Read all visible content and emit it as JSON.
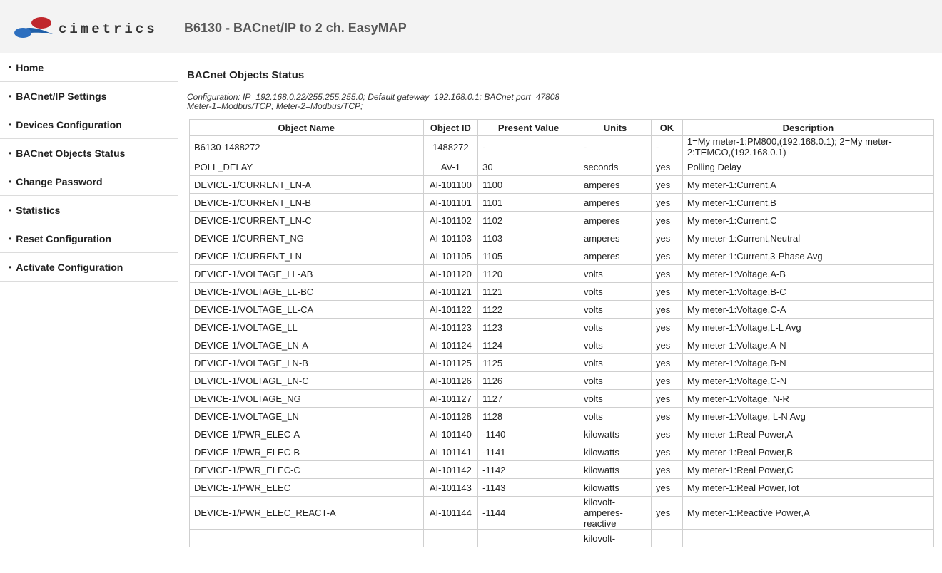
{
  "header": {
    "logo_text": "cimetrics",
    "title": "B6130 - BACnet/IP to 2 ch. EasyMAP"
  },
  "sidebar": {
    "items": [
      {
        "label": "Home"
      },
      {
        "label": "BACnet/IP Settings"
      },
      {
        "label": "Devices Configuration"
      },
      {
        "label": "BACnet Objects Status"
      },
      {
        "label": "Change Password"
      },
      {
        "label": "Statistics"
      },
      {
        "label": "Reset Configuration"
      },
      {
        "label": "Activate Configuration"
      }
    ]
  },
  "main": {
    "title": "BACnet Objects Status",
    "config_line1": "Configuration: IP=192.168.0.22/255.255.255.0; Default gateway=192.168.0.1; BACnet port=47808",
    "config_line2": "Meter-1=Modbus/TCP; Meter-2=Modbus/TCP;",
    "table": {
      "headers": [
        "Object Name",
        "Object ID",
        "Present Value",
        "Units",
        "OK",
        "Description"
      ],
      "rows": [
        [
          "B6130-1488272",
          "1488272",
          "-",
          "-",
          "-",
          "1=My meter-1:PM800,(192.168.0.1); 2=My meter-2:TEMCO,(192.168.0.1)"
        ],
        [
          "POLL_DELAY",
          "AV-1",
          "30",
          "seconds",
          "yes",
          "Polling Delay"
        ],
        [
          "DEVICE-1/CURRENT_LN-A",
          "AI-101100",
          "1100",
          "amperes",
          "yes",
          "My meter-1:Current,A"
        ],
        [
          "DEVICE-1/CURRENT_LN-B",
          "AI-101101",
          "1101",
          "amperes",
          "yes",
          "My meter-1:Current,B"
        ],
        [
          "DEVICE-1/CURRENT_LN-C",
          "AI-101102",
          "1102",
          "amperes",
          "yes",
          "My meter-1:Current,C"
        ],
        [
          "DEVICE-1/CURRENT_NG",
          "AI-101103",
          "1103",
          "amperes",
          "yes",
          "My meter-1:Current,Neutral"
        ],
        [
          "DEVICE-1/CURRENT_LN",
          "AI-101105",
          "1105",
          "amperes",
          "yes",
          "My meter-1:Current,3-Phase Avg"
        ],
        [
          "DEVICE-1/VOLTAGE_LL-AB",
          "AI-101120",
          "1120",
          "volts",
          "yes",
          "My meter-1:Voltage,A-B"
        ],
        [
          "DEVICE-1/VOLTAGE_LL-BC",
          "AI-101121",
          "1121",
          "volts",
          "yes",
          "My meter-1:Voltage,B-C"
        ],
        [
          "DEVICE-1/VOLTAGE_LL-CA",
          "AI-101122",
          "1122",
          "volts",
          "yes",
          "My meter-1:Voltage,C-A"
        ],
        [
          "DEVICE-1/VOLTAGE_LL",
          "AI-101123",
          "1123",
          "volts",
          "yes",
          "My meter-1:Voltage,L-L Avg"
        ],
        [
          "DEVICE-1/VOLTAGE_LN-A",
          "AI-101124",
          "1124",
          "volts",
          "yes",
          "My meter-1:Voltage,A-N"
        ],
        [
          "DEVICE-1/VOLTAGE_LN-B",
          "AI-101125",
          "1125",
          "volts",
          "yes",
          "My meter-1:Voltage,B-N"
        ],
        [
          "DEVICE-1/VOLTAGE_LN-C",
          "AI-101126",
          "1126",
          "volts",
          "yes",
          "My meter-1:Voltage,C-N"
        ],
        [
          "DEVICE-1/VOLTAGE_NG",
          "AI-101127",
          "1127",
          "volts",
          "yes",
          "My meter-1:Voltage, N-R"
        ],
        [
          "DEVICE-1/VOLTAGE_LN",
          "AI-101128",
          "1128",
          "volts",
          "yes",
          "My meter-1:Voltage, L-N Avg"
        ],
        [
          "DEVICE-1/PWR_ELEC-A",
          "AI-101140",
          "-1140",
          "kilowatts",
          "yes",
          "My meter-1:Real Power,A"
        ],
        [
          "DEVICE-1/PWR_ELEC-B",
          "AI-101141",
          "-1141",
          "kilowatts",
          "yes",
          "My meter-1:Real Power,B"
        ],
        [
          "DEVICE-1/PWR_ELEC-C",
          "AI-101142",
          "-1142",
          "kilowatts",
          "yes",
          "My meter-1:Real Power,C"
        ],
        [
          "DEVICE-1/PWR_ELEC",
          "AI-101143",
          "-1143",
          "kilowatts",
          "yes",
          "My meter-1:Real Power,Tot"
        ],
        [
          "DEVICE-1/PWR_ELEC_REACT-A",
          "AI-101144",
          "-1144",
          "kilovolt-amperes-reactive",
          "yes",
          "My meter-1:Reactive Power,A"
        ],
        [
          "",
          "",
          "",
          "kilovolt-",
          "",
          ""
        ]
      ]
    }
  },
  "colors": {
    "header_bg": "#f3f3f3",
    "border": "#cfcfcf",
    "logo_blue": "#1f5fa8",
    "logo_red": "#c0282d"
  }
}
